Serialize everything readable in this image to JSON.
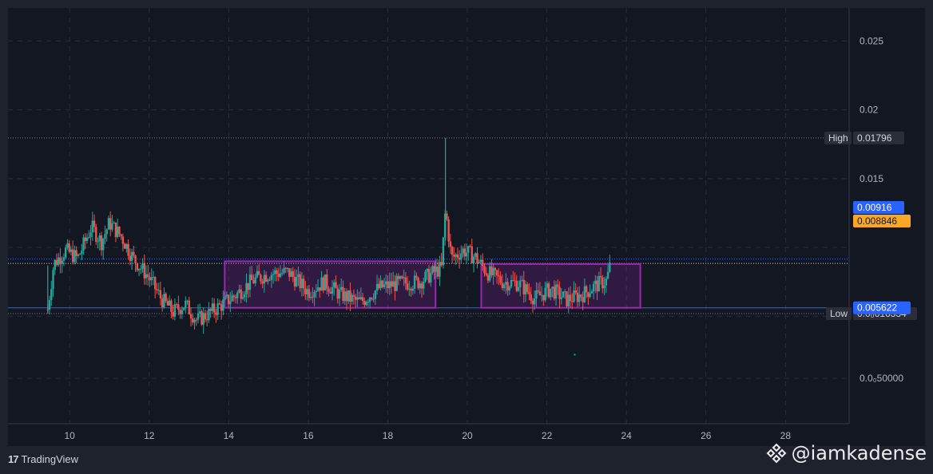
{
  "footer": {
    "brand": "TradingView",
    "watermark": "@iamkadense"
  },
  "colors": {
    "bg": "#131722",
    "frame": "#1e222d",
    "grid": "#2a2e39",
    "up": "#26a69a",
    "down": "#ef5350",
    "rect": "#9c27b0",
    "last_price_line": "#2962ff",
    "support_line": "#2962ff",
    "current_price": "#f9a825",
    "axis_text": "#b2b5be"
  },
  "chart_data": {
    "type": "candlestick",
    "x_ticks": [
      10,
      12,
      14,
      16,
      18,
      20,
      22,
      24,
      26,
      28
    ],
    "y_ticks": [
      {
        "value": 0.025,
        "label": "0.025"
      },
      {
        "value": 0.02,
        "label": "0.02"
      },
      {
        "value": 0.015,
        "label": "0.015"
      },
      {
        "value": 0.005,
        "label": "0.005"
      },
      {
        "value": 0.0005,
        "label": "0.0₀50000"
      }
    ],
    "xlim": [
      8.45,
      29.6
    ],
    "ylim": [
      -0.0028,
      0.0274
    ],
    "markers": {
      "high": {
        "label": "High",
        "value": 0.01796,
        "text": "0.01796"
      },
      "low": {
        "label": "Low",
        "value": 0.0052,
        "text": "0.0₀616334"
      },
      "last": {
        "value": 0.00916,
        "text": "0.00916"
      },
      "current": {
        "value": 0.008846,
        "text": "0.008846"
      },
      "support": {
        "value": 0.005622,
        "text": "0.005622"
      }
    },
    "ranges": [
      {
        "x0": 13.9,
        "x1": 19.2,
        "y0": 0.005622,
        "y1": 0.009
      },
      {
        "x0": 20.35,
        "x1": 24.35,
        "y0": 0.005622,
        "y1": 0.0088
      }
    ],
    "stray_points": [
      {
        "x": 22.7,
        "y": 0.00222
      }
    ],
    "series_keypoints": [
      [
        9.45,
        0.0055
      ],
      [
        9.6,
        0.0088
      ],
      [
        9.9,
        0.0098
      ],
      [
        10.2,
        0.0092
      ],
      [
        10.55,
        0.0115
      ],
      [
        10.8,
        0.0104
      ],
      [
        11.0,
        0.0118
      ],
      [
        11.3,
        0.0108
      ],
      [
        11.6,
        0.0092
      ],
      [
        12.0,
        0.0078
      ],
      [
        12.3,
        0.0063
      ],
      [
        12.6,
        0.0053
      ],
      [
        12.9,
        0.0059
      ],
      [
        13.2,
        0.0047
      ],
      [
        13.5,
        0.0052
      ],
      [
        13.8,
        0.0058
      ],
      [
        14.2,
        0.0066
      ],
      [
        14.6,
        0.0076
      ],
      [
        15.0,
        0.0081
      ],
      [
        15.5,
        0.0082
      ],
      [
        16.0,
        0.0068
      ],
      [
        16.4,
        0.0075
      ],
      [
        16.8,
        0.0066
      ],
      [
        17.3,
        0.006
      ],
      [
        17.8,
        0.0071
      ],
      [
        18.3,
        0.0074
      ],
      [
        18.8,
        0.0075
      ],
      [
        19.15,
        0.0082
      ],
      [
        19.35,
        0.0085
      ],
      [
        19.45,
        0.0128
      ],
      [
        19.6,
        0.0092
      ],
      [
        19.9,
        0.0098
      ],
      [
        20.2,
        0.0093
      ],
      [
        20.5,
        0.0082
      ],
      [
        20.9,
        0.0075
      ],
      [
        21.3,
        0.0074
      ],
      [
        21.7,
        0.0063
      ],
      [
        22.1,
        0.007
      ],
      [
        22.5,
        0.0062
      ],
      [
        22.9,
        0.0066
      ],
      [
        23.2,
        0.0072
      ],
      [
        23.5,
        0.0076
      ],
      [
        23.6,
        0.00885
      ]
    ]
  }
}
